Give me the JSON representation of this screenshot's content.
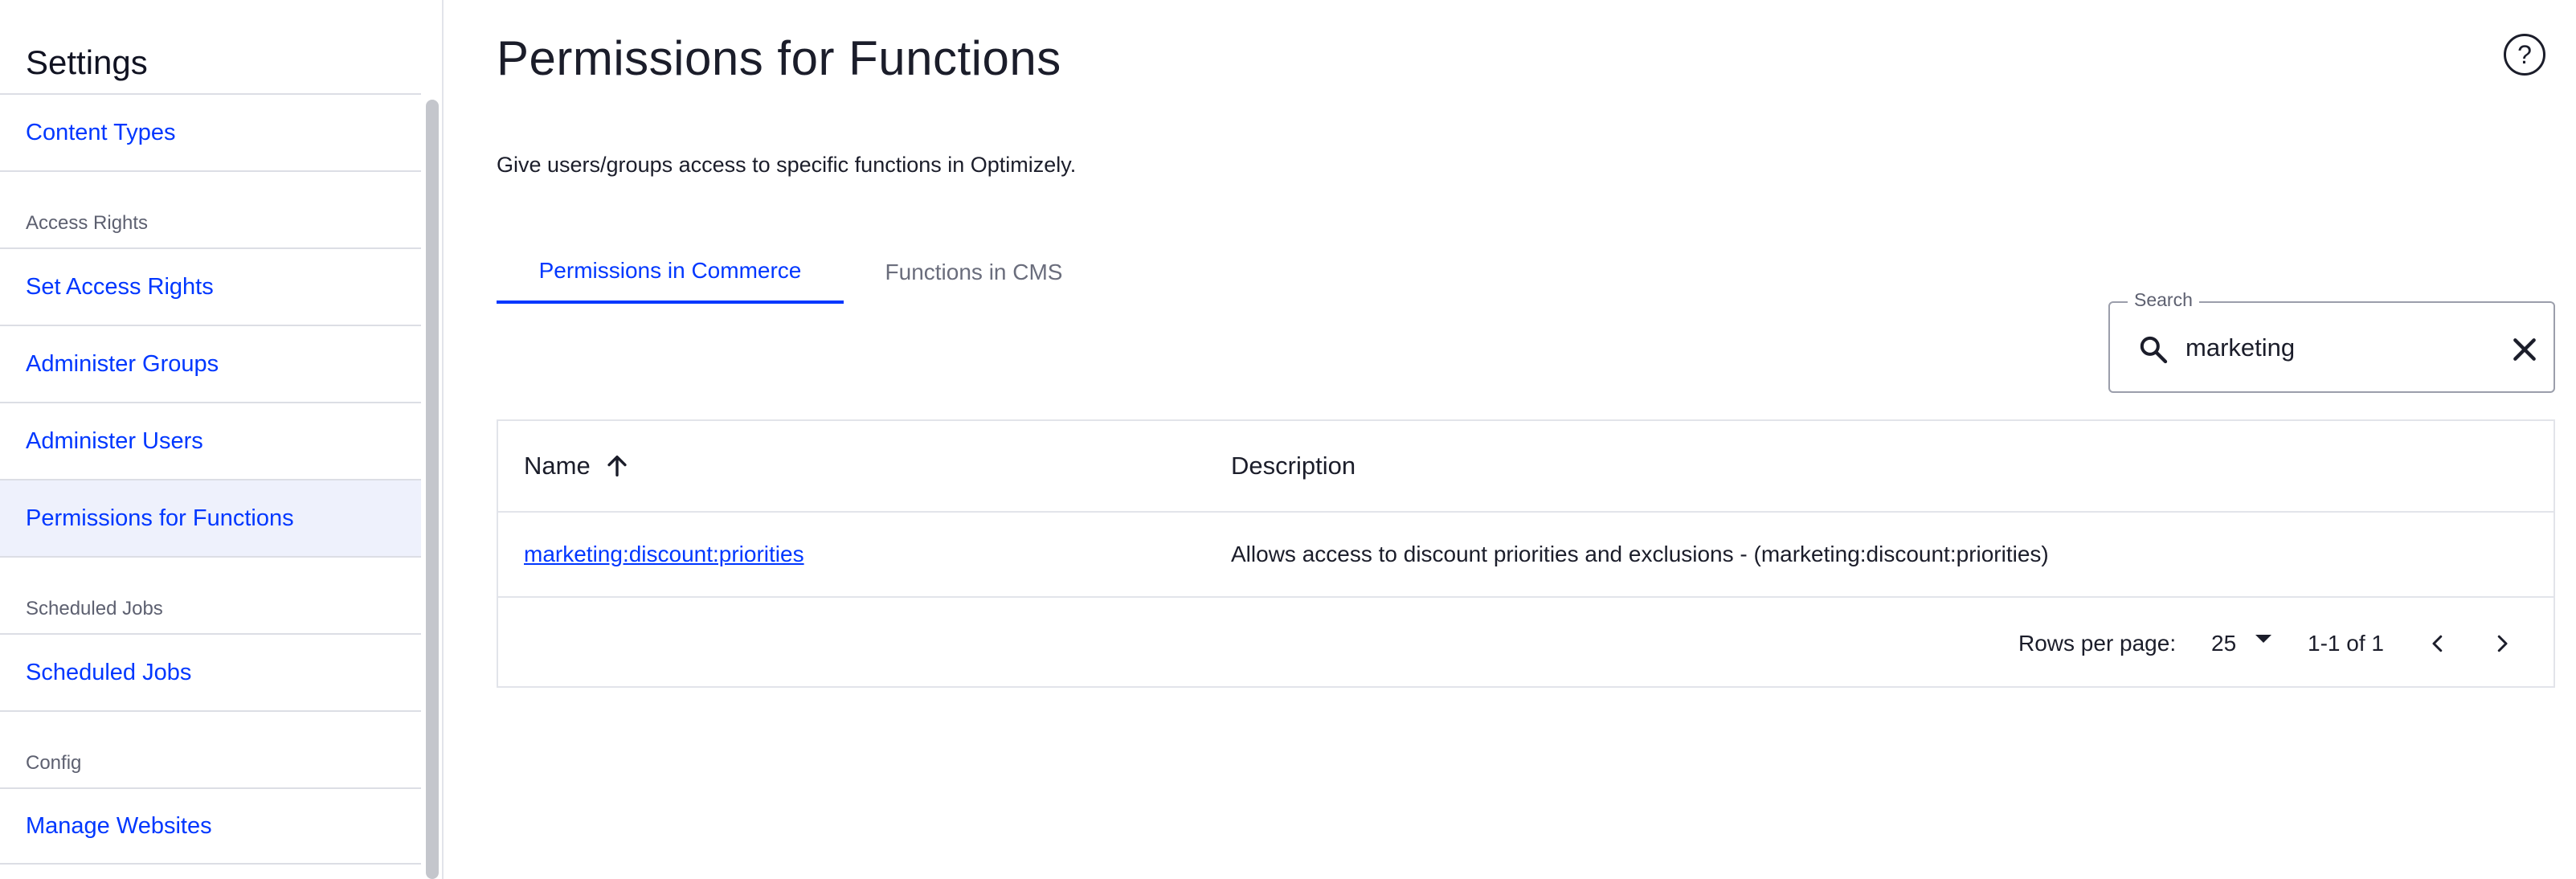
{
  "sidebar": {
    "title": "Settings",
    "items": [
      {
        "type": "link",
        "label": "Content Types"
      },
      {
        "type": "section",
        "label": "Access Rights"
      },
      {
        "type": "link",
        "label": "Set Access Rights"
      },
      {
        "type": "link",
        "label": "Administer Groups"
      },
      {
        "type": "link",
        "label": "Administer Users"
      },
      {
        "type": "link",
        "label": "Permissions for Functions",
        "active": true
      },
      {
        "type": "section",
        "label": "Scheduled Jobs"
      },
      {
        "type": "link",
        "label": "Scheduled Jobs"
      },
      {
        "type": "section",
        "label": "Config"
      },
      {
        "type": "link",
        "label": "Manage Websites"
      }
    ]
  },
  "main": {
    "title": "Permissions for Functions",
    "help_icon": "help-circle-icon",
    "help_glyph": "?",
    "intro": "Give users/groups access to specific functions in Optimizely.",
    "tabs": [
      {
        "label": "Permissions in Commerce",
        "active": true
      },
      {
        "label": "Functions in CMS",
        "active": false
      }
    ],
    "search": {
      "label": "Search",
      "value": "marketing",
      "search_icon": "search-icon",
      "clear_icon": "close-icon"
    },
    "table": {
      "columns": {
        "name": "Name",
        "description": "Description"
      },
      "sort_icon": "arrow-up-icon",
      "rows": [
        {
          "name": "marketing:discount:priorities",
          "description": "Allows access to discount priorities and exclusions - (marketing:discount:priorities)"
        }
      ],
      "pagination": {
        "rows_per_page_label": "Rows per page:",
        "rows_per_page": "25",
        "range": "1-1 of 1",
        "prev_icon": "chevron-left-icon",
        "next_icon": "chevron-right-icon"
      }
    }
  },
  "colors": {
    "link": "#0037ff",
    "active_nav_bg": "#eef1fc",
    "text": "#1b1d2a",
    "muted": "#5d6070",
    "border": "#e2e4ea"
  }
}
